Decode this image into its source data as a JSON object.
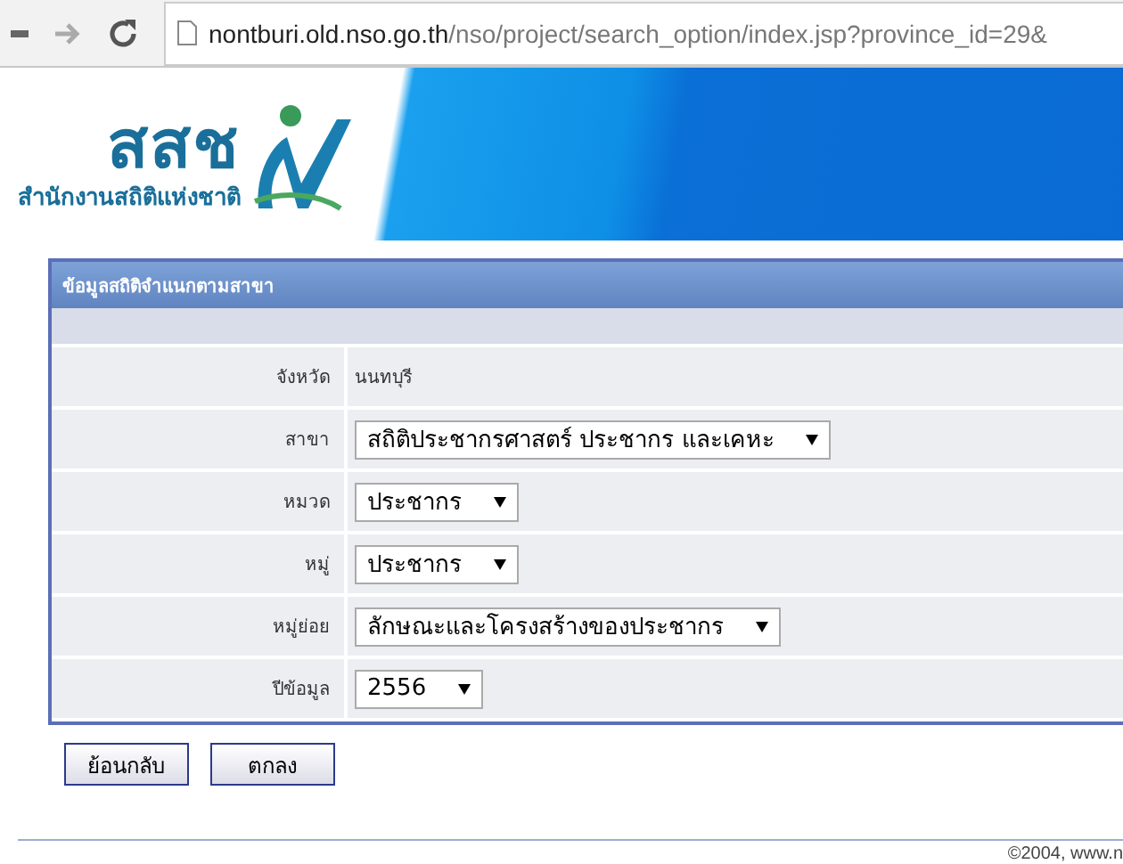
{
  "browser": {
    "url_host": "nontburi.old.nso.go.th",
    "url_path": "/nso/project/search_option/index.jsp?province_id=29&"
  },
  "banner": {
    "logo_letters": "สสช",
    "logo_subtitle": "สำนักงานสถิติแห่งชาติ"
  },
  "panel": {
    "title": "ข้อมูลสถิติจำแนกตามสาขา",
    "rows": [
      {
        "kind": "text",
        "label": "จังหวัด",
        "value": "นนทบุรี"
      },
      {
        "kind": "select",
        "label": "สาขา",
        "value": "สถิติประชากรศาสตร์ ประชากร และเคหะ"
      },
      {
        "kind": "select",
        "label": "หมวด",
        "value": "ประชากร"
      },
      {
        "kind": "select",
        "label": "หมู่",
        "value": "ประชากร"
      },
      {
        "kind": "select",
        "label": "หมู่ย่อย",
        "value": "ลักษณะและโครงสร้างของประชากร"
      },
      {
        "kind": "select",
        "label": "ปีข้อมูล",
        "value": "2556"
      }
    ]
  },
  "buttons": [
    "ย้อนกลับ",
    "ตกลง"
  ],
  "footer": {
    "copyright": "©2004, www.n"
  }
}
